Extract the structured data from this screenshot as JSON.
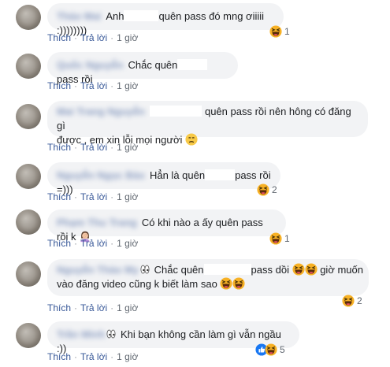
{
  "actions": {
    "like": "Thích",
    "reply": "Trả lời",
    "time": "1 giờ",
    "separator": "·"
  },
  "comments": [
    {
      "name": "Thảo Mai",
      "seg1": "Anh",
      "seg2": "quên pass đó mng ơiiiii :))))))))",
      "reactions": {
        "icons": [
          "haha-icon"
        ],
        "count": "1"
      }
    },
    {
      "name": "Quốc Nguyễn",
      "seg1": "Chắc quên",
      "seg2": "pass rồi",
      "reactions": null
    },
    {
      "name": "Mai Trang Nguyễn",
      "seg1": "quên pass rồi nên hông có đăng gì",
      "line2": "được , em xin lỗi mọi người",
      "reactions": null
    },
    {
      "name": "Nguyễn Ngọc Bảo",
      "seg1": "Hẳn là quên",
      "seg2": "pass rồi =)))",
      "reactions": {
        "icons": [
          "haha-icon"
        ],
        "count": "2"
      }
    },
    {
      "name": "Phạm Thu Trang",
      "seg1": "Có khi nào a ấy quên pass rồi k",
      "reactions": {
        "icons": [
          "haha-icon"
        ],
        "count": "1"
      }
    },
    {
      "name": "Nguyễn Thảo My",
      "seg1": "Chắc quên",
      "seg2": "pass dồi",
      "seg3": "giờ muốn",
      "line2": "vào đăng video cũng k biết làm sao",
      "reactions": {
        "icons": [
          "haha-icon"
        ],
        "count": "2"
      }
    },
    {
      "name": "Trần Minh",
      "seg1": "Khi bạn không cần làm gì vẫn ngầu :))",
      "reactions": {
        "icons": [
          "like-icon",
          "haha-icon"
        ],
        "count": "5"
      }
    }
  ]
}
